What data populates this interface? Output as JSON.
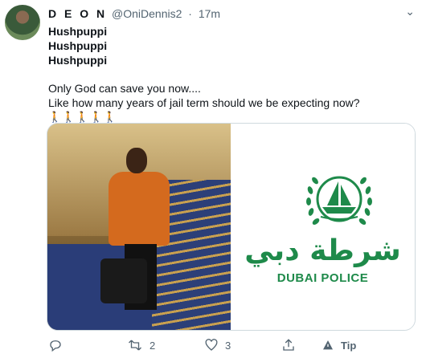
{
  "tweet": {
    "author_name": "D E O N",
    "handle": "@OniDennis2",
    "separator": "·",
    "time": "17m",
    "lines": [
      "Hushpuppi",
      "Hushpuppi",
      "Hushpuppi"
    ],
    "text_line1": "Only God can save you now....",
    "text_line2": "Like how many years of jail term should we be expecting now?",
    "emojis": "🚶🚶🚶🚶🚶"
  },
  "media": {
    "logo_arabic": "شرطة دبي",
    "logo_english": "DUBAI POLICE",
    "brand_color": "#1e8a4a"
  },
  "actions": {
    "reply_count": "",
    "retweet_count": "2",
    "like_count": "3",
    "tip_label": "Tip"
  }
}
